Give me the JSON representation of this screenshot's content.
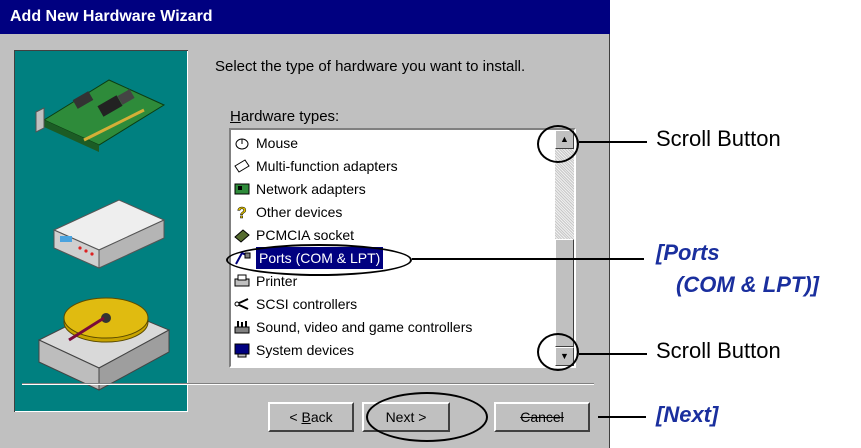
{
  "window": {
    "title": "Add New Hardware Wizard"
  },
  "instruction": "Select the type of hardware you want to install.",
  "list": {
    "label_prefix": "H",
    "label_rest": "ardware types:",
    "items": [
      {
        "label": "Mouse",
        "icon": "mouse-icon"
      },
      {
        "label": "Multi-function adapters",
        "icon": "multifunction-adapter-icon"
      },
      {
        "label": "Network adapters",
        "icon": "network-adapter-icon"
      },
      {
        "label": "Other devices",
        "icon": "question-icon"
      },
      {
        "label": "PCMCIA socket",
        "icon": "pcmcia-socket-icon"
      },
      {
        "label": "Ports (COM & LPT)",
        "icon": "port-icon",
        "selected": true
      },
      {
        "label": "Printer",
        "icon": "printer-icon"
      },
      {
        "label": "SCSI controllers",
        "icon": "scsi-controller-icon"
      },
      {
        "label": "Sound, video and game controllers",
        "icon": "sound-video-icon"
      },
      {
        "label": "System devices",
        "icon": "system-devices-icon"
      }
    ],
    "scroll_up_glyph": "▲",
    "scroll_down_glyph": "▼"
  },
  "buttons": {
    "back_prefix": "< ",
    "back_key": "B",
    "back_rest": "ack",
    "next": "Next >",
    "cancel": "Cancel"
  },
  "callouts": {
    "scroll_top": "Scroll Button",
    "ports_line1": "[Ports",
    "ports_line2": "(COM & LPT)]",
    "scroll_bottom": "Scroll Button",
    "next": "[Next]"
  },
  "colors": {
    "titlebar": "#000080",
    "callout_blue": "#1a2f9e",
    "art_bg": "#008080"
  }
}
